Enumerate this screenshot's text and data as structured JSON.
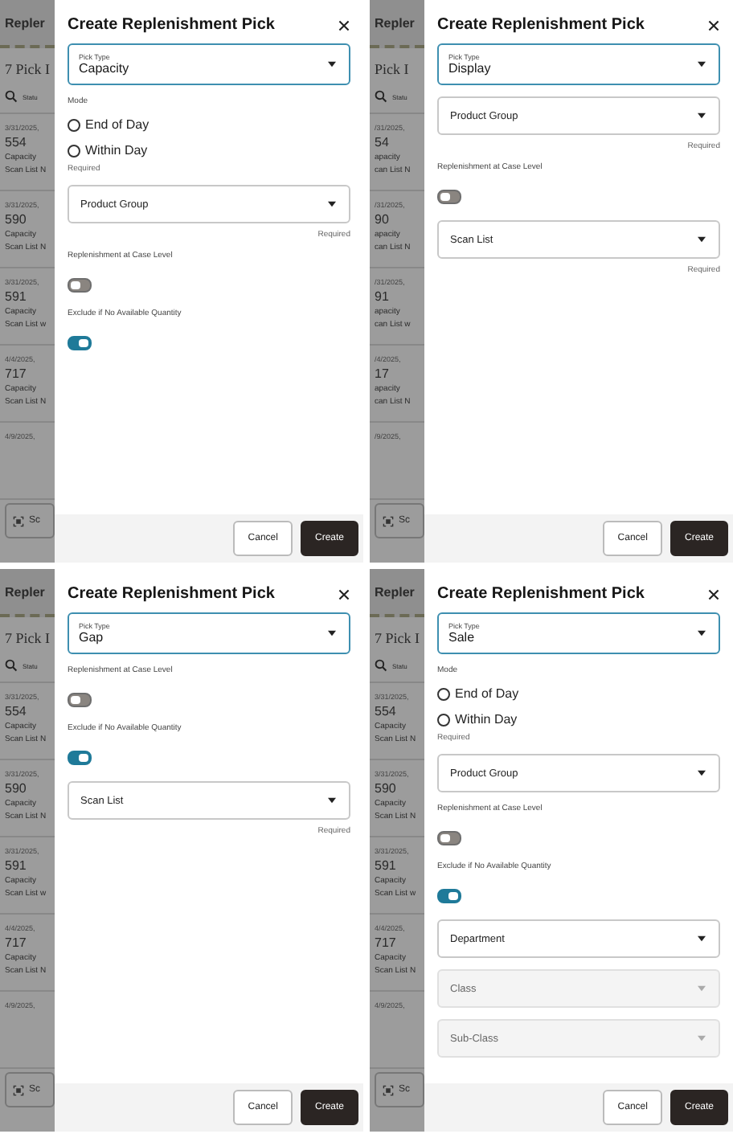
{
  "panels": [
    {
      "background": {
        "header": "Repler",
        "title": "7 Pick I",
        "status": "Statu",
        "items": [
          [
            "3/31/2025,",
            "554",
            "Capacity",
            "Scan List N"
          ],
          [
            "3/31/2025,",
            "590",
            "Capacity",
            "Scan List N"
          ],
          [
            "3/31/2025,",
            "591",
            "Capacity",
            "Scan List w"
          ],
          [
            "4/4/2025,",
            "717",
            "Capacity",
            "Scan List N"
          ],
          [
            "4/9/2025,"
          ]
        ],
        "scan_label": "Sc"
      },
      "dialog": {
        "title": "Create Replenishment Pick",
        "pick_type": {
          "label": "Pick Type",
          "value": "Capacity",
          "focused": true
        },
        "fields": [
          {
            "kind": "label",
            "text": "Mode"
          },
          {
            "kind": "radio",
            "label": "End of Day",
            "selected": false
          },
          {
            "kind": "radio",
            "label": "Within Day",
            "selected": false
          },
          {
            "kind": "helper",
            "text": "Required"
          },
          {
            "kind": "select",
            "label": "Product Group",
            "disabled": false,
            "helper": "Required"
          },
          {
            "kind": "label",
            "text": "Replenishment at Case Level"
          },
          {
            "kind": "toggle",
            "on": false
          },
          {
            "kind": "label",
            "text": "Exclude if No Available Quantity"
          },
          {
            "kind": "toggle",
            "on": true
          }
        ],
        "buttons": [
          {
            "label": "Cancel",
            "kind": "secondary"
          },
          {
            "label": "Create",
            "kind": "primary"
          }
        ]
      }
    },
    {
      "background": {
        "header": "Repler",
        "title": "Pick I",
        "status": "Statu",
        "items": [
          [
            "/31/2025,",
            "54",
            "apacity",
            "can List N"
          ],
          [
            "/31/2025,",
            "90",
            "apacity",
            "can List N"
          ],
          [
            "/31/2025,",
            "91",
            "apacity",
            "can List w"
          ],
          [
            "/4/2025,",
            "17",
            "apacity",
            "can List N"
          ],
          [
            "/9/2025,"
          ]
        ],
        "scan_label": "Sc"
      },
      "dialog": {
        "title": "Create Replenishment Pick",
        "pick_type": {
          "label": "Pick Type",
          "value": "Display",
          "focused": true
        },
        "fields": [
          {
            "kind": "select",
            "label": "Product Group",
            "disabled": false,
            "helper": "Required"
          },
          {
            "kind": "label",
            "text": "Replenishment at Case Level"
          },
          {
            "kind": "toggle",
            "on": false
          },
          {
            "kind": "select",
            "label": "Scan List",
            "disabled": false,
            "helper": "Required"
          }
        ],
        "buttons": [
          {
            "label": "Cancel",
            "kind": "secondary"
          },
          {
            "label": "Create",
            "kind": "primary"
          }
        ]
      }
    },
    {
      "background": {
        "header": "Repler",
        "title": "7 Pick I",
        "status": "Statu",
        "items": [
          [
            "3/31/2025,",
            "554",
            "Capacity",
            "Scan List N"
          ],
          [
            "3/31/2025,",
            "590",
            "Capacity",
            "Scan List N"
          ],
          [
            "3/31/2025,",
            "591",
            "Capacity",
            "Scan List w"
          ],
          [
            "4/4/2025,",
            "717",
            "Capacity",
            "Scan List N"
          ],
          [
            "4/9/2025,"
          ]
        ],
        "scan_label": "Sc"
      },
      "dialog": {
        "title": "Create Replenishment Pick",
        "pick_type": {
          "label": "Pick Type",
          "value": "Gap",
          "focused": true
        },
        "fields": [
          {
            "kind": "label",
            "text": "Replenishment at Case Level"
          },
          {
            "kind": "toggle",
            "on": false
          },
          {
            "kind": "label",
            "text": "Exclude if No Available Quantity"
          },
          {
            "kind": "toggle",
            "on": true
          },
          {
            "kind": "select",
            "label": "Scan List",
            "disabled": false,
            "helper": "Required"
          }
        ],
        "buttons": [
          {
            "label": "Cancel",
            "kind": "secondary"
          },
          {
            "label": "Create",
            "kind": "primary"
          }
        ]
      }
    },
    {
      "background": {
        "header": "Repler",
        "title": "7 Pick I",
        "status": "Statu",
        "items": [
          [
            "3/31/2025,",
            "554",
            "Capacity",
            "Scan List N"
          ],
          [
            "3/31/2025,",
            "590",
            "Capacity",
            "Scan List N"
          ],
          [
            "3/31/2025,",
            "591",
            "Capacity",
            "Scan List w"
          ],
          [
            "4/4/2025,",
            "717",
            "Capacity",
            "Scan List N"
          ],
          [
            "4/9/2025,"
          ]
        ],
        "scan_label": "Sc"
      },
      "dialog": {
        "title": "Create Replenishment Pick",
        "pick_type": {
          "label": "Pick Type",
          "value": "Sale",
          "focused": true
        },
        "fields": [
          {
            "kind": "label",
            "text": "Mode"
          },
          {
            "kind": "radio",
            "label": "End of Day",
            "selected": false
          },
          {
            "kind": "radio",
            "label": "Within Day",
            "selected": false
          },
          {
            "kind": "helper",
            "text": "Required"
          },
          {
            "kind": "select",
            "label": "Product Group",
            "disabled": false
          },
          {
            "kind": "label",
            "text": "Replenishment at Case Level"
          },
          {
            "kind": "toggle",
            "on": false
          },
          {
            "kind": "label",
            "text": "Exclude if No Available Quantity"
          },
          {
            "kind": "toggle",
            "on": true
          },
          {
            "kind": "select",
            "label": "Department",
            "disabled": false
          },
          {
            "kind": "select",
            "label": "Class",
            "disabled": true
          },
          {
            "kind": "select",
            "label": "Sub-Class",
            "disabled": true
          }
        ],
        "buttons": [
          {
            "label": "Cancel",
            "kind": "secondary"
          },
          {
            "label": "Create",
            "kind": "primary"
          }
        ]
      }
    }
  ]
}
